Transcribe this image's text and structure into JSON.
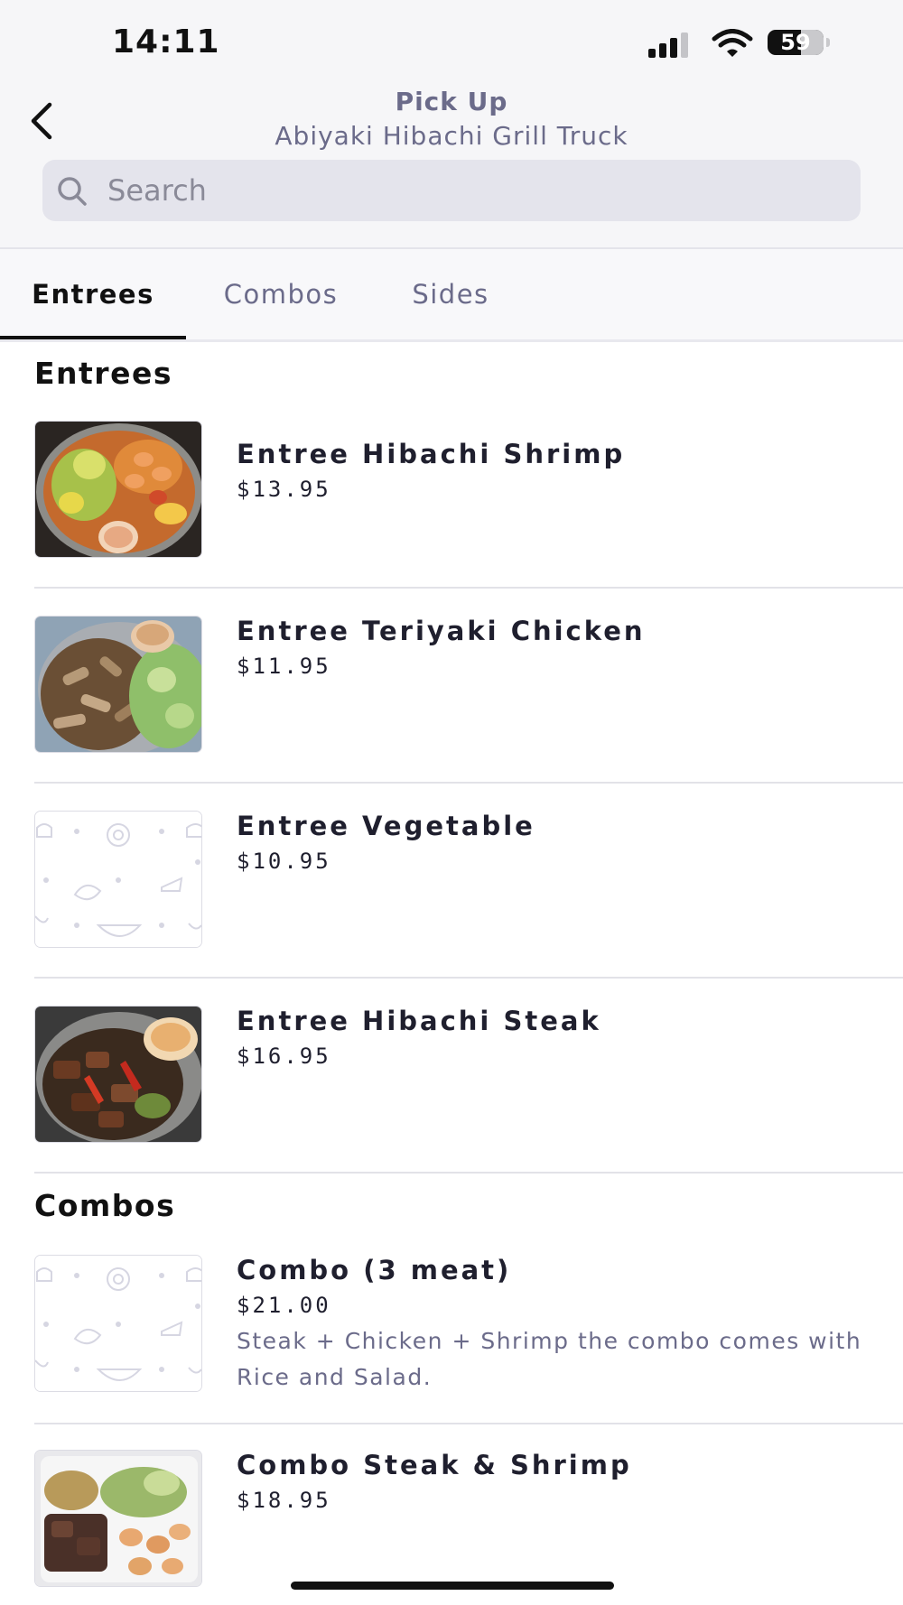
{
  "status_bar": {
    "time": "14:11",
    "battery_level": "59",
    "battery_fraction": 0.59,
    "icons": [
      "signal-icon",
      "wifi-icon",
      "battery-icon"
    ]
  },
  "header": {
    "title": "Pick Up",
    "subtitle": "Abiyaki Hibachi Grill Truck",
    "back_icon": "chevron-left-icon"
  },
  "search": {
    "placeholder": "Search",
    "value": "",
    "icon": "search-icon"
  },
  "tabs": [
    {
      "label": "Entrees",
      "active": true
    },
    {
      "label": "Combos",
      "active": false
    },
    {
      "label": "Sides",
      "active": false
    }
  ],
  "sections": [
    {
      "title": "Entrees",
      "items": [
        {
          "name": "Entree Hibachi Shrimp",
          "price": "$13.95",
          "image": "photo-shrimp"
        },
        {
          "name": "Entree Teriyaki Chicken",
          "price": "$11.95",
          "image": "photo-chicken"
        },
        {
          "name": "Entree Vegetable",
          "price": "$10.95",
          "image": "placeholder-food-pattern"
        },
        {
          "name": "Entree Hibachi Steak",
          "price": "$16.95",
          "image": "photo-steak"
        }
      ]
    },
    {
      "title": "Combos",
      "items": [
        {
          "name": "Combo (3 meat)",
          "price": "$21.00",
          "description": "Steak + Chicken + Shrimp the combo comes with Rice and Salad.",
          "image": "placeholder-food-pattern"
        },
        {
          "name": "Combo Steak & Shrimp",
          "price": "$18.95",
          "image": "photo-steak-shrimp"
        }
      ]
    }
  ],
  "colors": {
    "accent_text": "#6b6b8a",
    "primary_text": "#1f1f2e",
    "search_bg": "#e4e4ec",
    "divider": "#e2e2e8"
  }
}
